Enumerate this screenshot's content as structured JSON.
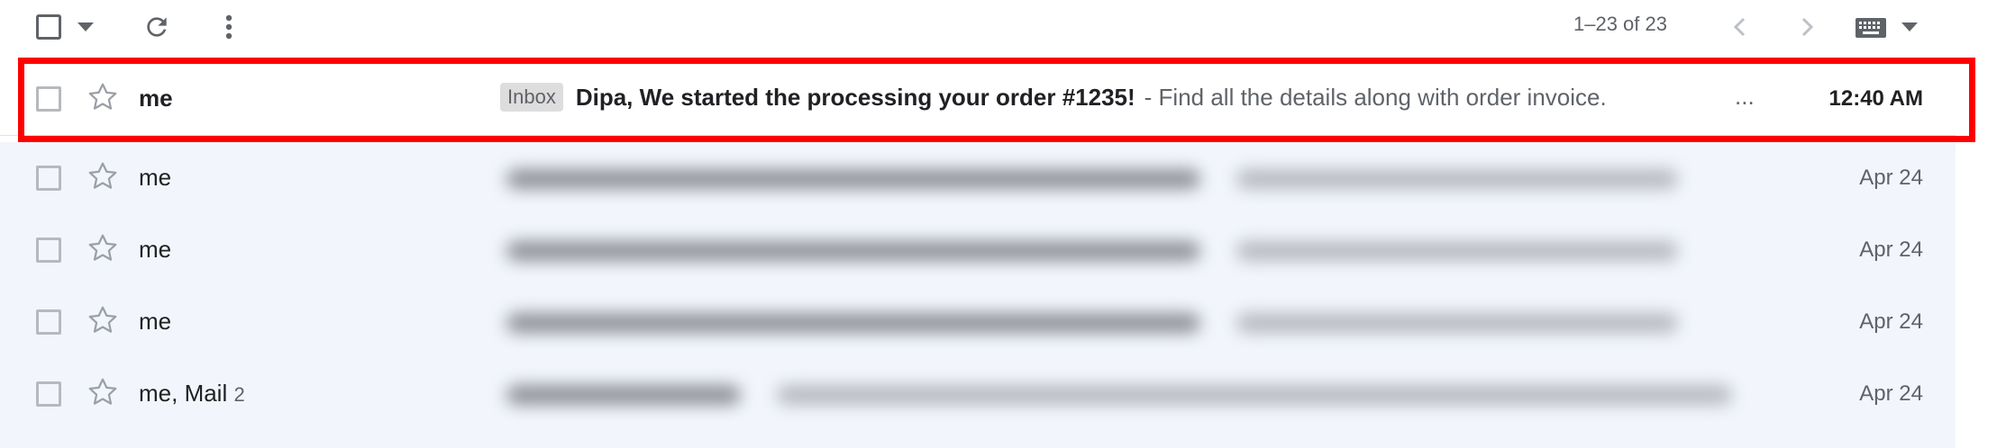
{
  "toolbar": {
    "pagination": "1–23 of 23",
    "icons": [
      "select-all-checkbox",
      "select-dropdown-caret",
      "refresh-icon",
      "more-vert-icon",
      "chevron-left-icon",
      "chevron-right-icon",
      "keyboard-icon",
      "input-tools-caret"
    ]
  },
  "emails": [
    {
      "sender": "me",
      "label": "Inbox",
      "subject": "Dipa, We started the processing your order #1235!",
      "snippet": "- Find all the details along with order invoice.",
      "ellipsis": "...",
      "date": "12:40 AM",
      "unread": true
    },
    {
      "sender": "me",
      "date": "Apr 24",
      "unread": false
    },
    {
      "sender": "me",
      "date": "Apr 24",
      "unread": false
    },
    {
      "sender": "me",
      "date": "Apr 24",
      "unread": false
    },
    {
      "sender": "me, Mail",
      "thread_count": "2",
      "date": "Apr 24",
      "unread": false
    }
  ],
  "colors": {
    "highlight": "#ff0000",
    "read_row_bg": "#f2f6fc",
    "unread_row_bg": "#ffffff"
  }
}
